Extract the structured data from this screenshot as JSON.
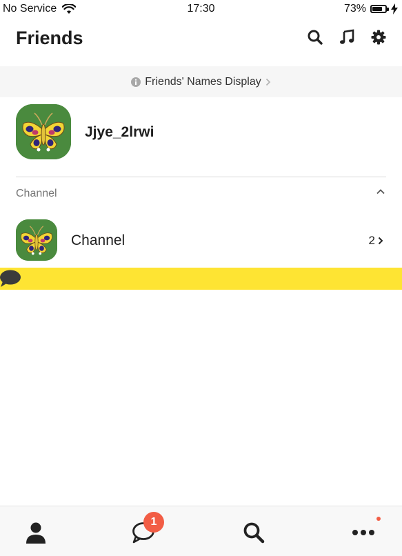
{
  "status_bar": {
    "carrier": "No Service",
    "time": "17:30",
    "battery": "73%",
    "battery_level": 0.73,
    "icons": [
      "wifi-icon",
      "battery-icon",
      "charging-bolt-icon"
    ]
  },
  "header": {
    "title": "Friends",
    "icons": [
      "search-icon",
      "music-note-icon",
      "gear-icon"
    ]
  },
  "names_banner": {
    "label": "Friends' Names Display",
    "icons": [
      "info-icon",
      "chevron-right-icon"
    ]
  },
  "profile": {
    "name": "Jjye_2lrwi",
    "avatar": "butterfly-avatar"
  },
  "channel_section": {
    "title": "Channel",
    "collapse_icon": "chevron-up-icon",
    "items": [
      {
        "name": "Channel",
        "count": "2",
        "avatar": "butterfly-avatar"
      }
    ]
  },
  "tab_bar": {
    "tabs": [
      "person-icon",
      "chat-bubble-icon",
      "search-icon",
      "more-dots-icon"
    ],
    "chat_badge": "1"
  },
  "colors": {
    "yellow_bar": "#fee433",
    "badge": "#f25d45",
    "avatar_bg": "#4a8a3e"
  }
}
